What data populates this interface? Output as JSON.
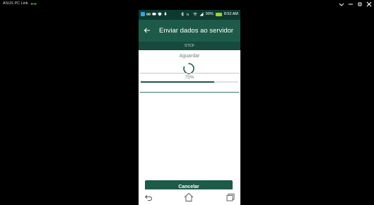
{
  "window": {
    "title": "ASUS PC Link",
    "icon": "link-icon"
  },
  "statusbar": {
    "battery": "99%",
    "time": "8:52 AM"
  },
  "appbar": {
    "title": "Enviar dados ao servidor",
    "back_icon": "arrow-left-icon"
  },
  "subtitle": "STCF",
  "progress": {
    "status": "Aguardar",
    "percent_label": "75%",
    "value": 0.75
  },
  "cancel_label": "Cancelar",
  "navbar": {
    "back_icon": "back-icon",
    "home_icon": "home-icon",
    "recents_icon": "recents-icon"
  },
  "colors": {
    "statusbar": "#0d3a30",
    "appbar": "#1e5a48",
    "subtitle_bar": "#164a3c",
    "accent": "#1e5a48",
    "battery": "#9ed12e"
  }
}
